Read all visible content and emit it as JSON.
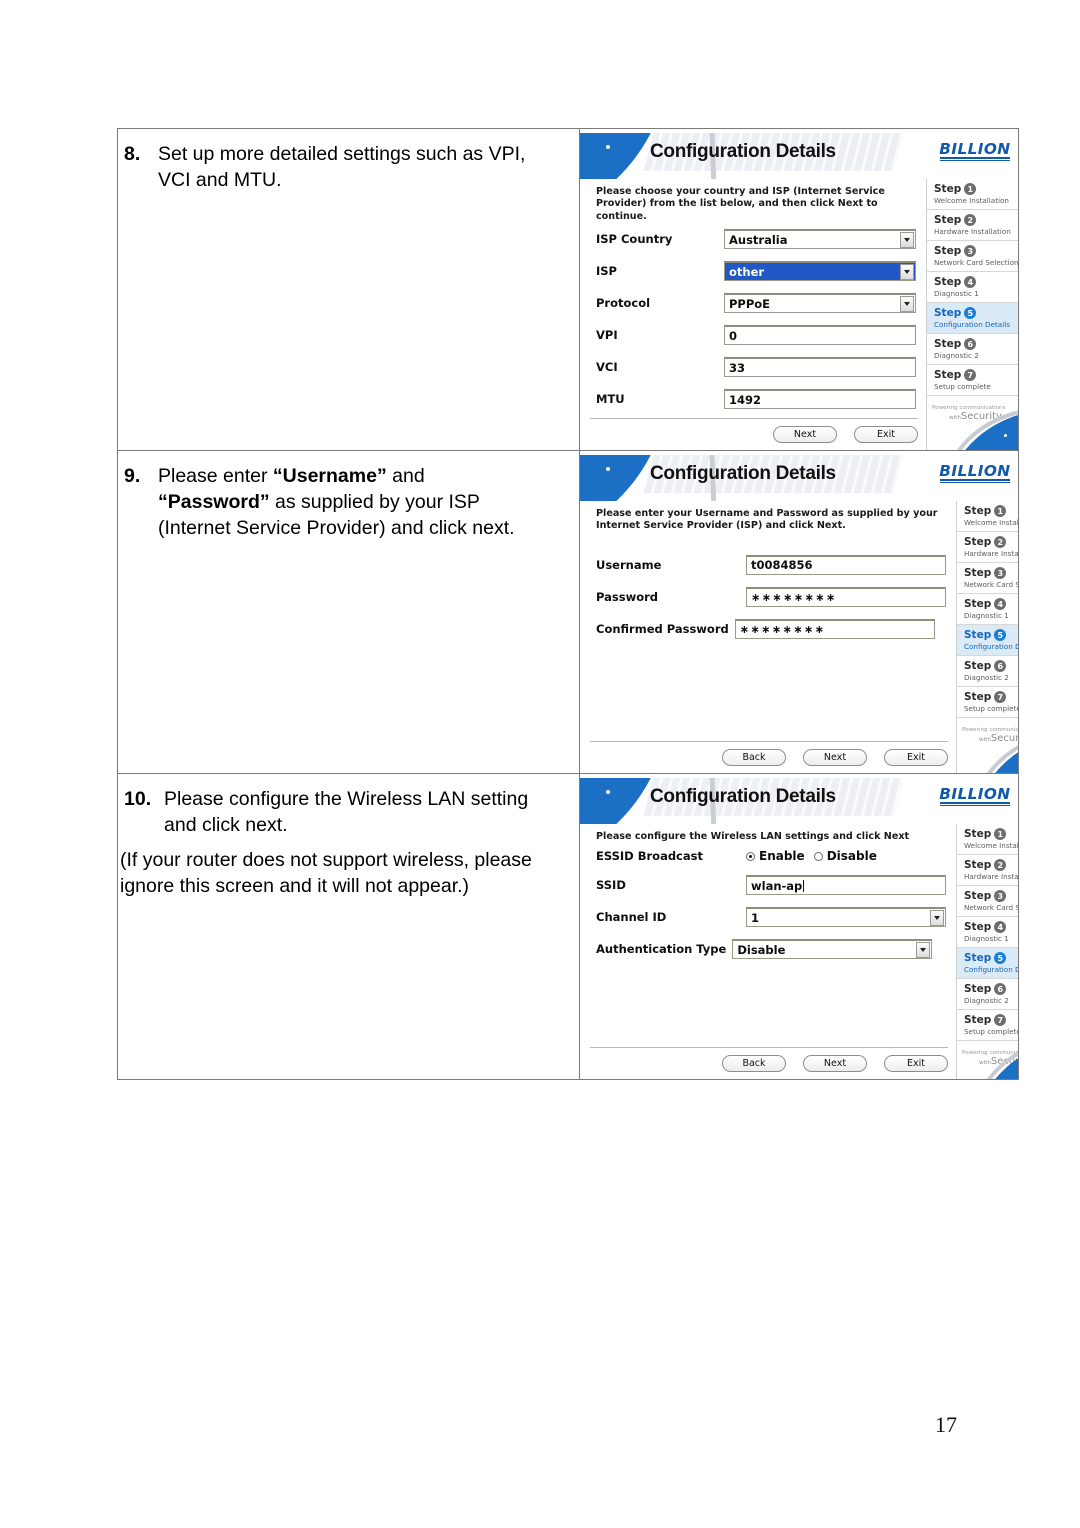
{
  "page": {
    "number": "17"
  },
  "instructions": [
    {
      "number": "8.",
      "line1": "Set up more detailed settings such as VPI,",
      "line2": "VCI and MTU."
    },
    {
      "number": "9.",
      "pre": "Please enter ",
      "bold1": "“Username”",
      "mid": " and",
      "bold2": "“Password”",
      "post": " as supplied by your ISP",
      "line3": "(Internet Service Provider) and click next."
    },
    {
      "number": "10.",
      "line1": "Please configure the Wireless LAN setting",
      "line2": "and click next.",
      "para1": "(If your router does not support wireless, please",
      "para2": "ignore this screen and it will not appear.)"
    }
  ],
  "wizard": {
    "title": "Configuration Details",
    "brand": "BILLION",
    "buttons": {
      "back": "Back",
      "next": "Next",
      "exit": "Exit"
    },
    "footer": {
      "tagline_top": "Powering communications",
      "tagline_small": "with",
      "tagline_main": "Security"
    },
    "steps": [
      {
        "word": "Step",
        "num": "1",
        "sub": "Welcome Installation"
      },
      {
        "word": "Step",
        "num": "2",
        "sub": "Hardware Installation"
      },
      {
        "word": "Step",
        "num": "3",
        "sub": "Network Card Selection"
      },
      {
        "word": "Step",
        "num": "4",
        "sub": "Diagnostic 1"
      },
      {
        "word": "Step",
        "num": "5",
        "sub": "Configuration Details"
      },
      {
        "word": "Step",
        "num": "6",
        "sub": "Diagnostic 2"
      },
      {
        "word": "Step",
        "num": "7",
        "sub": "Setup complete"
      }
    ],
    "active_step_index": 4
  },
  "screen1": {
    "description": "Please choose your country and ISP (Internet Service Provider) from the list below, and then click Next to continue.",
    "fields": [
      {
        "label": "ISP Country",
        "value": "Australia",
        "type": "select"
      },
      {
        "label": "ISP",
        "value": "other",
        "type": "select"
      },
      {
        "label": "Protocol",
        "value": "PPPoE",
        "type": "select"
      },
      {
        "label": "VPI",
        "value": "0",
        "type": "text"
      },
      {
        "label": "VCI",
        "value": "33",
        "type": "text"
      },
      {
        "label": "MTU",
        "value": "1492",
        "type": "text"
      }
    ]
  },
  "screen2": {
    "description": "Please enter your Username and Password as supplied by your Internet Service Provider (ISP) and click Next.",
    "fields": [
      {
        "label": "Username",
        "value": "t0084856",
        "type": "text"
      },
      {
        "label": "Password",
        "value": "∗∗∗∗∗∗∗∗",
        "type": "password"
      },
      {
        "label": "Confirmed Password",
        "value": "∗∗∗∗∗∗∗∗",
        "type": "password"
      }
    ]
  },
  "screen3": {
    "description": "Please configure the Wireless LAN settings and click Next",
    "essid_label": "ESSID Broadcast",
    "essid_enable": "Enable",
    "essid_disable": "Disable",
    "essid_selected": "Enable",
    "fields": [
      {
        "label": "SSID",
        "value": "wlan-ap",
        "type": "text"
      },
      {
        "label": "Channel ID",
        "value": "1",
        "type": "select"
      },
      {
        "label": "Authentication Type",
        "value": "Disable",
        "type": "select"
      }
    ]
  }
}
